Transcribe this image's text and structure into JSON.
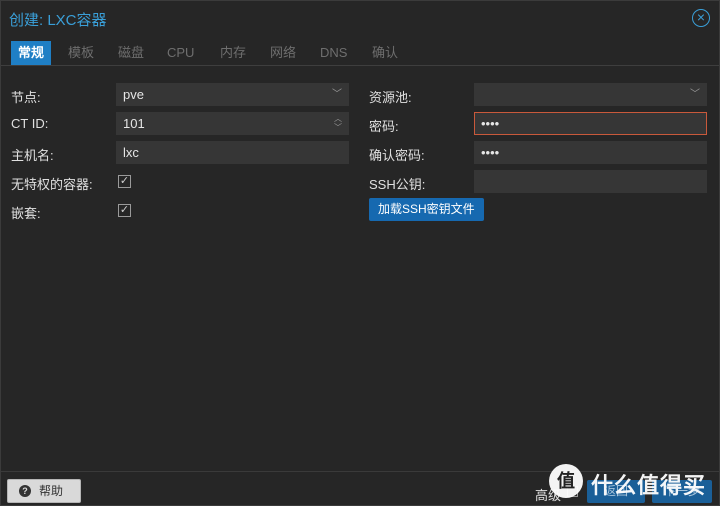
{
  "window": {
    "title": "创建: LXC容器",
    "close_icon": "close-icon"
  },
  "tabs": [
    {
      "label": "常规",
      "active": true
    },
    {
      "label": "模板"
    },
    {
      "label": "磁盘"
    },
    {
      "label": "CPU"
    },
    {
      "label": "内存"
    },
    {
      "label": "网络"
    },
    {
      "label": "DNS"
    },
    {
      "label": "确认"
    }
  ],
  "form": {
    "node_label": "节点:",
    "node_value": "pve",
    "ctid_label": "CT ID:",
    "ctid_value": "101",
    "hostname_label": "主机名:",
    "hostname_value": "lxc",
    "unprivileged_label": "无特权的容器:",
    "unprivileged_checked": true,
    "nesting_label": "嵌套:",
    "nesting_checked": true,
    "pool_label": "资源池:",
    "pool_value": "",
    "password_label": "密码:",
    "password_value": "••••",
    "confirm_label": "确认密码:",
    "confirm_value": "••••",
    "ssh_label": "SSH公钥:",
    "ssh_value": "",
    "load_ssh_button": "加载SSH密钥文件"
  },
  "footer": {
    "help_label": "帮助",
    "advanced_label": "高级",
    "back_label": "返回",
    "next_label": "下一步"
  },
  "watermark": {
    "text": "什么值得买",
    "logo_char": "值"
  },
  "colors": {
    "accent": "#3a9fd8",
    "tab_active": "#1f7fc5",
    "error_border": "#c9593b",
    "button": "#1669b0"
  }
}
